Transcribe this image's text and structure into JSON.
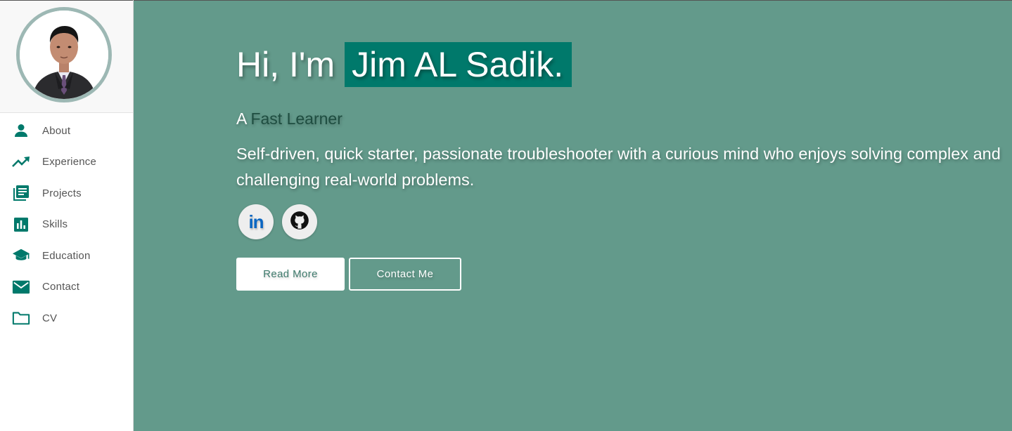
{
  "sidebar": {
    "avatar_alt": "Profile photo",
    "items": [
      {
        "label": "About",
        "icon": "person-icon"
      },
      {
        "label": "Experience",
        "icon": "trending-up-icon"
      },
      {
        "label": "Projects",
        "icon": "library-books-icon"
      },
      {
        "label": "Skills",
        "icon": "bar-chart-icon"
      },
      {
        "label": "Education",
        "icon": "school-icon"
      },
      {
        "label": "Contact",
        "icon": "email-icon"
      },
      {
        "label": "CV",
        "icon": "folder-icon"
      }
    ]
  },
  "hero": {
    "greeting": "Hi, I'm",
    "name": "Jim AL Sadik.",
    "tagline_prefix": "A",
    "tagline_highlight": "Fast Learner",
    "intro": "Self-driven, quick starter, passionate troubleshooter with a curious mind who enjoys solving complex and challenging real-world problems.",
    "socials": [
      {
        "name": "LinkedIn",
        "icon": "linkedin-icon",
        "text": "in"
      },
      {
        "name": "GitHub",
        "icon": "github-icon"
      }
    ],
    "read_more_label": "Read More",
    "contact_label": "Contact Me"
  },
  "colors": {
    "hero_bg": "#639a8b",
    "name_highlight": "#00796b",
    "nav_icon": "#00796b",
    "tagline_accent": "#1e4d40",
    "avatar_border": "#9db8b4",
    "linkedin": "#0a66c2"
  }
}
